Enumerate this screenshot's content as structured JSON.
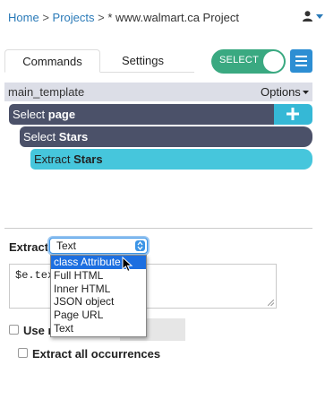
{
  "breadcrumb": {
    "home": "Home",
    "sep1": ">",
    "projects": "Projects",
    "sep2": ">",
    "current": "* www.walmart.ca Project"
  },
  "header": {
    "user_icon": "user-icon",
    "caret_icon": "caret-down-icon"
  },
  "tabs": [
    {
      "label": "Commands",
      "active": true
    },
    {
      "label": "Settings",
      "active": false
    }
  ],
  "select_toggle": {
    "label": "SELECT",
    "on": true,
    "color": "#3aa981"
  },
  "menu_button": {
    "icon": "hamburger-icon",
    "color": "#2d8ed3"
  },
  "template": {
    "name": "main_template",
    "options_label": "Options"
  },
  "commands": [
    {
      "prefix": "Select",
      "target": "page"
    },
    {
      "prefix": "Select",
      "target": "Stars"
    },
    {
      "prefix": "Extract",
      "target": "Stars"
    }
  ],
  "extract_panel": {
    "label": "Extract",
    "selected": "Text",
    "expression": "$e.text",
    "use_label": "Use r",
    "extract_all_label": "Extract all occurrences",
    "options": [
      "class Attribute",
      "Full HTML",
      "Inner HTML",
      "JSON object",
      "Page URL",
      "Text"
    ],
    "highlighted": "class Attribute"
  }
}
